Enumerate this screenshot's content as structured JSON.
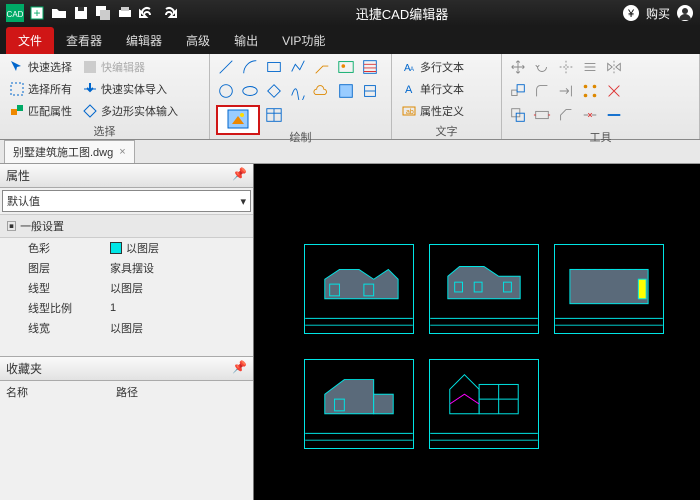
{
  "app": {
    "title": "迅捷CAD编辑器",
    "buy": "购买"
  },
  "topIcons": [
    "cad",
    "new",
    "open",
    "save",
    "saveas",
    "print",
    "undo",
    "redo"
  ],
  "tabs": [
    {
      "label": "文件",
      "active": true
    },
    {
      "label": "查看器"
    },
    {
      "label": "编辑器"
    },
    {
      "label": "高级"
    },
    {
      "label": "输出"
    },
    {
      "label": "VIP功能"
    }
  ],
  "ribbon": {
    "select": {
      "label": "选择",
      "items": [
        "快速选择",
        "选择所有",
        "匹配属性",
        "快编辑器",
        "快速实体导入",
        "多边形实体输入"
      ]
    },
    "draw": {
      "label": "绘制"
    },
    "text": {
      "label": "文字",
      "items": [
        "多行文本",
        "单行文本",
        "属性定义"
      ]
    },
    "tools": {
      "label": "工具"
    }
  },
  "doc": {
    "name": "别墅建筑施工图.dwg"
  },
  "props": {
    "title": "属性",
    "combo": "默认值",
    "section": "一般设置",
    "rows": [
      {
        "k": "色彩",
        "v": "以图层",
        "swatch": true
      },
      {
        "k": "图层",
        "v": "家具摆设"
      },
      {
        "k": "线型",
        "v": "以图层"
      },
      {
        "k": "线型比例",
        "v": "1"
      },
      {
        "k": "线宽",
        "v": "以图层"
      }
    ]
  },
  "fav": {
    "title": "收藏夹",
    "col1": "名称",
    "col2": "路径"
  }
}
